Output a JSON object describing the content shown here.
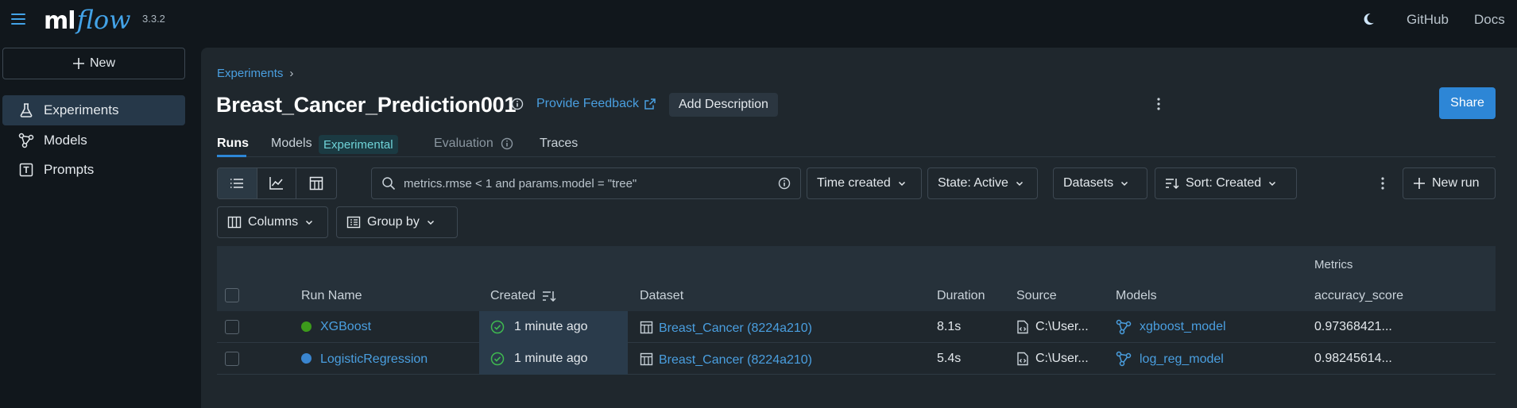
{
  "app": {
    "logo_ml": "ml",
    "logo_flow": "flow",
    "version": "3.3.2",
    "top_links": [
      "GitHub",
      "Docs"
    ]
  },
  "sidebar": {
    "new_label": "New",
    "items": [
      {
        "label": "Experiments",
        "icon": "flask-icon",
        "active": true
      },
      {
        "label": "Models",
        "icon": "models-icon",
        "active": false
      },
      {
        "label": "Prompts",
        "icon": "prompts-icon",
        "active": false
      }
    ]
  },
  "header": {
    "breadcrumb": "Experiments",
    "breadcrumb_sep": "›",
    "title": "Breast_Cancer_Prediction001",
    "feedback": "Provide Feedback",
    "add_description": "Add Description",
    "share": "Share"
  },
  "tabs": {
    "runs": "Runs",
    "models": "Models",
    "models_tag": "Experimental",
    "evaluation": "Evaluation",
    "traces": "Traces"
  },
  "toolbar": {
    "search_placeholder": "metrics.rmse < 1 and params.model = \"tree\"",
    "time_created": "Time created",
    "state": "State: Active",
    "datasets": "Datasets",
    "sort": "Sort: Created",
    "new_run": "New run",
    "columns": "Columns",
    "group_by": "Group by"
  },
  "table": {
    "group_header": "Metrics",
    "columns": {
      "run_name": "Run Name",
      "created": "Created",
      "dataset": "Dataset",
      "duration": "Duration",
      "source": "Source",
      "models": "Models",
      "metric": "accuracy_score"
    },
    "rows": [
      {
        "run_name": "XGBoost",
        "status_color": "#3c9a1b",
        "created": "1 minute ago",
        "dataset": "Breast_Cancer (8224a210)",
        "duration": "8.1s",
        "source": "C:\\User...",
        "model": "xgboost_model",
        "accuracy": "0.97368421..."
      },
      {
        "run_name": "LogisticRegression",
        "status_color": "#3a85cf",
        "created": "1 minute ago",
        "dataset": "Breast_Cancer (8224a210)",
        "duration": "5.4s",
        "source": "C:\\User...",
        "model": "log_reg_model",
        "accuracy": "0.98245614..."
      }
    ]
  },
  "colors": {
    "accent": "#2d86d6",
    "link": "#4a9fe0",
    "success": "#3fb950"
  }
}
